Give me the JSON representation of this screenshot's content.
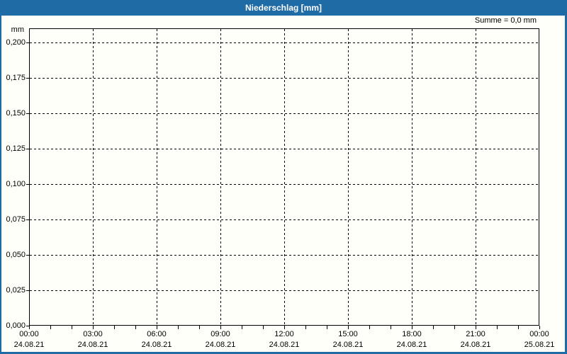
{
  "window": {
    "title": "Niederschlag [mm]"
  },
  "colors": {
    "titlebar_bg": "#1f6ba5",
    "frame_border": "#1f6ba5",
    "title_text": "#ffffff",
    "panel_bg": "#fffffa",
    "grid": "#000000",
    "axis": "#000000",
    "label_text": "#000000"
  },
  "chart_data": {
    "type": "line",
    "title": "Niederschlag [mm]",
    "unit_label": "mm",
    "sum_text": "Summe = 0,0 mm",
    "grid": true,
    "legend": null,
    "series": [
      {
        "name": "Niederschlag",
        "values": []
      }
    ],
    "ylim": [
      0,
      0.21
    ],
    "ylabel": "mm",
    "y_ticks": [
      {
        "label": "0,200",
        "value": 0.2
      },
      {
        "label": "0,175",
        "value": 0.175
      },
      {
        "label": "0,150",
        "value": 0.15
      },
      {
        "label": "0,125",
        "value": 0.125
      },
      {
        "label": "0,100",
        "value": 0.1
      },
      {
        "label": "0,075",
        "value": 0.075
      },
      {
        "label": "0,050",
        "value": 0.05
      },
      {
        "label": "0,025",
        "value": 0.025
      },
      {
        "label": "0,000",
        "value": 0.0
      }
    ],
    "x_axis": {
      "hours_total": 24,
      "minor_tick_hours": 1,
      "major_tick_hours": 3,
      "major_ticks": [
        {
          "time": "00:00",
          "date": "24.08.21"
        },
        {
          "time": "03:00",
          "date": "24.08.21"
        },
        {
          "time": "06:00",
          "date": "24.08.21"
        },
        {
          "time": "09:00",
          "date": "24.08.21"
        },
        {
          "time": "12:00",
          "date": "24.08.21"
        },
        {
          "time": "15:00",
          "date": "24.08.21"
        },
        {
          "time": "18:00",
          "date": "24.08.21"
        },
        {
          "time": "21:00",
          "date": "24.08.21"
        },
        {
          "time": "00:00",
          "date": "25.08.21"
        }
      ]
    }
  }
}
